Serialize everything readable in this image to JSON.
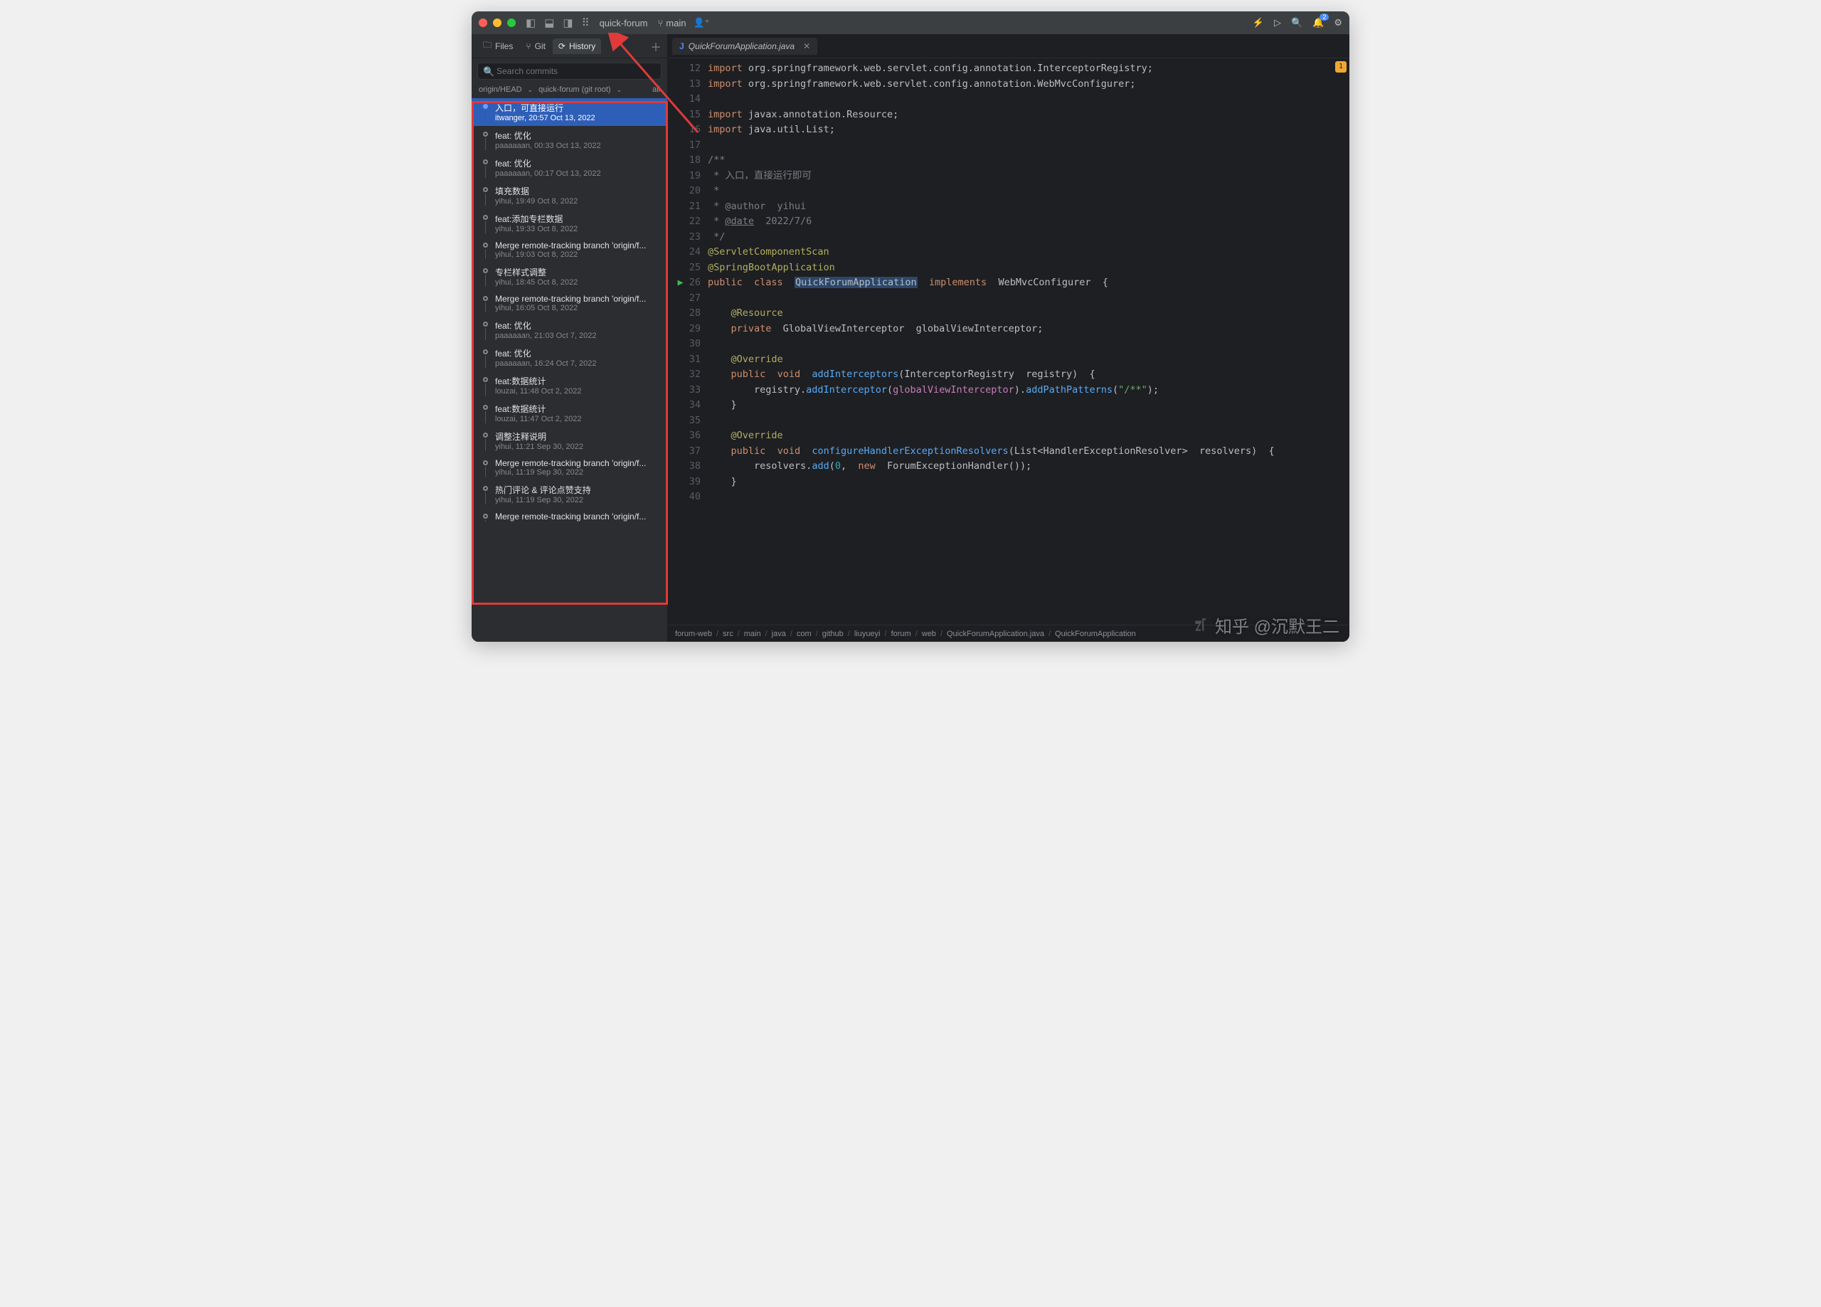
{
  "titlebar": {
    "project": "quick-forum",
    "branch": "main",
    "notif_count": "2"
  },
  "sidebar": {
    "tabs": {
      "files": "Files",
      "git": "Git",
      "history": "History"
    },
    "search_placeholder": "Search commits",
    "branch_label": "origin/HEAD",
    "scope": "quick-forum (git root)",
    "all": "all"
  },
  "commits": [
    {
      "msg": "入口，可直接运行",
      "sub": "itwanger, 20:57 Oct 13, 2022",
      "sel": true,
      "filled": true
    },
    {
      "msg": "feat: 优化",
      "sub": "paaaaaan, 00:33 Oct 13, 2022"
    },
    {
      "msg": "feat: 优化",
      "sub": "paaaaaan, 00:17 Oct 13, 2022"
    },
    {
      "msg": "填充数据",
      "sub": "yihui, 19:49 Oct 8, 2022"
    },
    {
      "msg": "feat:添加专栏数据",
      "sub": "yihui, 19:33 Oct 8, 2022"
    },
    {
      "msg": "Merge remote-tracking branch 'origin/f...",
      "sub": "yihui, 19:03 Oct 8, 2022",
      "merge": true
    },
    {
      "msg": "专栏样式调整",
      "sub": "yihui, 18:45 Oct 8, 2022"
    },
    {
      "msg": "Merge remote-tracking branch 'origin/f...",
      "sub": "yihui, 16:05 Oct 8, 2022",
      "merge": true
    },
    {
      "msg": "feat: 优化",
      "sub": "paaaaaan, 21:03 Oct 7, 2022"
    },
    {
      "msg": "feat: 优化",
      "sub": "paaaaaan, 16:24 Oct 7, 2022"
    },
    {
      "msg": "feat:数据统计",
      "sub": "louzai, 11:48 Oct 2, 2022"
    },
    {
      "msg": "feat:数据统计",
      "sub": "louzai, 11:47 Oct 2, 2022"
    },
    {
      "msg": "调整注释说明",
      "sub": "yihui, 11:21 Sep 30, 2022"
    },
    {
      "msg": "Merge remote-tracking branch 'origin/f...",
      "sub": "yihui, 11:19 Sep 30, 2022",
      "merge": true
    },
    {
      "msg": "热门评论 & 评论点赞支持",
      "sub": "yihui, 11:19 Sep 30, 2022"
    },
    {
      "msg": "Merge remote-tracking branch 'origin/f...",
      "sub": "",
      "merge": true
    }
  ],
  "editor": {
    "tab": "QuickForumApplication.java",
    "warn": "1"
  },
  "lines": [
    {
      "n": "12",
      "html": "<span class='kw'>import</span> org.springframework.web.servlet.config.annotation.<span class='cls'>InterceptorRegistry</span>;"
    },
    {
      "n": "13",
      "html": "<span class='kw'>import</span> org.springframework.web.servlet.config.annotation.<span class='cls'>WebMvcConfigurer</span>;"
    },
    {
      "n": "14",
      "html": ""
    },
    {
      "n": "15",
      "html": "<span class='kw'>import</span> javax.annotation.<span class='cls'>Resource</span>;"
    },
    {
      "n": "16",
      "html": "<span class='kw'>import</span> java.util.<span class='cls'>List</span>;"
    },
    {
      "n": "17",
      "html": ""
    },
    {
      "n": "18",
      "html": "<span class='com'>/**</span>"
    },
    {
      "n": "19",
      "html": "<span class='com'> * 入口，直接运行即可</span>"
    },
    {
      "n": "20",
      "html": "<span class='com'> *</span>"
    },
    {
      "n": "21",
      "html": "<span class='com'> * @author  yihui</span>"
    },
    {
      "n": "22",
      "html": "<span class='com'> * <span class='under'>@date</span>  2022/7/6</span>"
    },
    {
      "n": "23",
      "html": "<span class='com'> */</span>"
    },
    {
      "n": "24",
      "html": "<span class='ann'>@ServletComponentScan</span>"
    },
    {
      "n": "25",
      "html": "<span class='ann'>@SpringBootApplication</span>"
    },
    {
      "n": "26",
      "run": true,
      "html": "<span class='kw'>public</span>  <span class='kw'>class</span>  <span class='hl'>QuickForumApplication</span>  <span class='kw'>implements</span>  WebMvcConfigurer  {"
    },
    {
      "n": "27",
      "html": ""
    },
    {
      "n": "28",
      "html": "    <span class='ann'>@Resource</span>"
    },
    {
      "n": "29",
      "html": "    <span class='kw'>private</span>  GlobalViewInterceptor  globalViewInterceptor;"
    },
    {
      "n": "30",
      "html": ""
    },
    {
      "n": "31",
      "html": "    <span class='ann'>@Override</span>"
    },
    {
      "n": "32",
      "html": "    <span class='kw'>public</span>  <span class='kw'>void</span>  <span class='fn'>addInterceptors</span>(<span class='cls'>InterceptorRegistry</span>  registry)  {"
    },
    {
      "n": "33",
      "html": "        registry.<span class='fn'>addInterceptor</span>(<span class='id'>globalViewInterceptor</span>).<span class='fn'>addPathPatterns</span>(<span class='str'>\"/**\"</span>);"
    },
    {
      "n": "34",
      "html": "    }"
    },
    {
      "n": "35",
      "html": ""
    },
    {
      "n": "36",
      "html": "    <span class='ann'>@Override</span>"
    },
    {
      "n": "37",
      "html": "    <span class='kw'>public</span>  <span class='kw'>void</span>  <span class='fn'>configureHandlerExceptionResolvers</span>(<span class='cls'>List</span>&lt;<span class='cls'>HandlerExceptionResolver</span>&gt;  resolvers)  {"
    },
    {
      "n": "38",
      "html": "        resolvers.<span class='fn'>add</span>(<span class='num'>0</span>,  <span class='kw'>new</span>  ForumExceptionHandler());"
    },
    {
      "n": "39",
      "html": "    }"
    },
    {
      "n": "40",
      "html": ""
    }
  ],
  "crumbs": [
    "forum-web",
    "src",
    "main",
    "java",
    "com",
    "github",
    "liuyueyi",
    "forum",
    "web",
    "QuickForumApplication.java",
    "QuickForumApplication"
  ],
  "watermark": "知乎 @沉默王二"
}
